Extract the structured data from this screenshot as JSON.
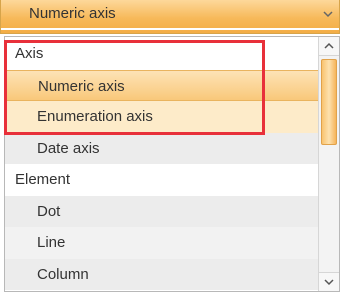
{
  "combo": {
    "selected_value": "Numeric axis"
  },
  "list": {
    "items": [
      {
        "label": "Axis"
      },
      {
        "label": "Numeric axis"
      },
      {
        "label": "Enumeration axis"
      },
      {
        "label": "Date axis"
      },
      {
        "label": "Element"
      },
      {
        "label": "Dot"
      },
      {
        "label": "Line"
      },
      {
        "label": "Column"
      }
    ]
  },
  "colors": {
    "accent": "#f7b95a",
    "highlight_border": "#e8303a"
  },
  "icons": {
    "combo_arrow": "chevron-down-icon",
    "scroll_up": "chevron-up-icon",
    "scroll_down": "chevron-down-icon"
  }
}
